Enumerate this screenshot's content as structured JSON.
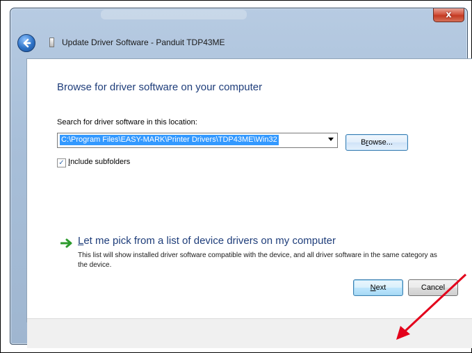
{
  "window": {
    "title": "Update Driver Software - Panduit TDP43ME",
    "close_glyph": "x"
  },
  "content": {
    "heading": "Browse for driver software on your computer",
    "search_label": "Search for driver software in this location:",
    "path_value": "C:\\Program Files\\EASY-MARK\\Printer Drivers\\TDP43ME\\Win32",
    "browse_label_pre": "B",
    "browse_label_accel": "r",
    "browse_label_post": "owse...",
    "include_subfolders": {
      "checked": true,
      "accel": "I",
      "label_rest": "nclude subfolders"
    },
    "pick_link_accel": "L",
    "pick_link_rest": "et me pick from a list of device drivers on my computer",
    "pick_description": "This list will show installed driver software compatible with the device, and all driver software in the same category as the device."
  },
  "footer": {
    "next_accel": "N",
    "next_rest": "ext",
    "cancel_label": "Cancel"
  },
  "colors": {
    "heading": "#1e3d7a",
    "selection": "#3399ff",
    "annotation_arrow": "#e3001b"
  },
  "icons": [
    "back-arrow-icon",
    "device-icon",
    "close-icon",
    "dropdown-arrow-icon",
    "green-arrow-icon",
    "checkmark-icon"
  ]
}
